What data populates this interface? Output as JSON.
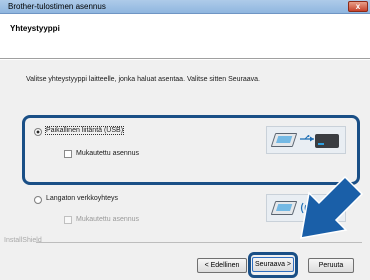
{
  "window": {
    "title": "Brother-tulostimen asennus",
    "close_label": "x"
  },
  "header": {
    "heading": "Yhteystyyppi"
  },
  "instruction": "Valitse yhteystyyppi laitteelle, jonka haluat asentaa. Valitse sitten Seuraava.",
  "options": [
    {
      "label": "Paikallinen liitäntä (USB)",
      "selected": true,
      "checkbox_label": "Mukautettu asennus",
      "checkbox_checked": false,
      "checkbox_enabled": true
    },
    {
      "label": "Langaton verkkoyhteys",
      "selected": false,
      "checkbox_label": "Mukautettu asennus",
      "checkbox_checked": false,
      "checkbox_enabled": false
    }
  ],
  "footer": {
    "brand": "InstallShield"
  },
  "buttons": {
    "back": "< Edellinen",
    "next": "Seuraava >",
    "cancel": "Peruuta"
  },
  "colors": {
    "highlight": "#1a4f86",
    "arrow": "#1a5fa8"
  }
}
